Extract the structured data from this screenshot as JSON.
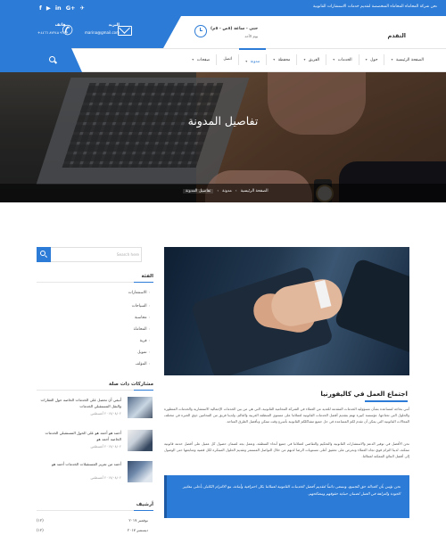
{
  "topbar": {
    "text": "نحن شركة المحاماه المحاماه المتخصصة لتقديم خدمات الاستشارات القانونية",
    "social": [
      {
        "icon": "twitter-icon",
        "glyph": "✈︎"
      },
      {
        "icon": "google-plus-icon",
        "glyph": "G+"
      },
      {
        "icon": "linkedin-icon",
        "glyph": "in"
      },
      {
        "icon": "youtube-icon",
        "glyph": "▶"
      },
      {
        "icon": "facebook-icon",
        "glyph": "f"
      }
    ]
  },
  "contact": {
    "phone_title": "هاتف",
    "phone_value": "+٩٦٦ ٨٧٣٤٥ ٤٤٦٦",
    "email_title": "البريد",
    "email_value": "marina@gmail.com",
    "hours_title": "حتى - ساعة (٨ص - ٥م)",
    "hours_sub": "يوم الأحد"
  },
  "logo": "التقدم",
  "nav": {
    "items": [
      {
        "label": "الصفحة الرئيسية",
        "arrow": true,
        "active": false
      },
      {
        "label": "حول",
        "arrow": true,
        "active": false
      },
      {
        "label": "الخدمات",
        "arrow": true,
        "active": false
      },
      {
        "label": "الفريق",
        "arrow": true,
        "active": false
      },
      {
        "label": "محفظة",
        "arrow": true,
        "active": false
      },
      {
        "label": "مدونة",
        "arrow": true,
        "active": true
      },
      {
        "label": "اتصل",
        "arrow": false,
        "active": false
      },
      {
        "label": "صفحات",
        "arrow": true,
        "active": false
      }
    ]
  },
  "hero": {
    "title": "تفاصيل المدونة",
    "breadcrumbs": [
      "الصفحة الرئيسية",
      "مدونة",
      "تفاصيل المدونة"
    ]
  },
  "sidebar": {
    "search_placeholder": "Search here",
    "categories_title": "الفئة",
    "categories": [
      "الاستثمارات",
      "السياحات",
      "محاسبة",
      "المحاماة",
      "قرية",
      "تمويل",
      "المؤلف"
    ],
    "recent_title": "مشاركات ذات صلة",
    "recent": [
      {
        "title": "أنبغي أن تحصل على الخدمات الخاصة حول العقارات والنقل المستقبلي الخدمات",
        "date": "٢٠١٧/٠٨/٠٢ أغسطس"
      },
      {
        "title": "أحمد هو أحمد هو على الحول المستقبلي الخدمات الخاصة أحمد هو",
        "date": "٢٠١٧/٠٨/٠٢ أغسطس"
      },
      {
        "title": "أحمد من تعزيز المستقبلات الخدمات أحمد هو",
        "date": "٢٠١٧/٠٨/٠٢ أغسطس"
      }
    ],
    "archives_title": "أرشيف",
    "archives": [
      {
        "month": "نوفمبر ٢٠١٧",
        "count": "(١٢)"
      },
      {
        "month": "ديسمبر ٢٠١٧",
        "count": "(١٢)"
      }
    ]
  },
  "article": {
    "title": "اجتماع العمل في كاليفورنيا",
    "para1": "أنني بحاجة لمساعدة بشأن مسؤولية الخدمات المقدمة للعديد من العملاء في الشركة المحامية القانونية، التي هي من بين الخدمات الإجمالية الاستشارية والخدمات المتطورة والحلول التي تحتاجها. مؤسسة كبيرة تهتم بتقديم أفضل الخدمات القانونية لعملائنا على مستوى المنطقة العربية والعالم، ولدينا فريق من المحامين ذوي الخبرة في مختلف المجالات القانونية التي يمكن أن تقدم لكم المساعدة في حل جميع مشاكلكم القانونية بأسرع وقت ممكن وبأفضل الطرق المتاحة.",
    "para2": "نحن الأفضل في توفير الدعم والاستشارات القانونية والتحكيم والتقاضي لعملائنا في جميع أنحاء المنطقة، ونعمل بجد لضمان حصول كل عميل على أفضل خدمة قانونية ممكنة، لدينا التزام قوي تجاه العملاء ونحرص على تحقيق أعلى مستويات الرضا لديهم من خلال التواصل المستمر وتقديم الحلول المبتكرة لكل قضية ومتابعتها حتى الوصول إلى أفضل النتائج الممكنة لعملائنا.",
    "quote": "نحن نؤمن بأن العدالة حق للجميع، ونسعى دائماً لتقديم أفضل الخدمات القانونية لعملائنا بكل احترافية وأمانة، مع الالتزام الكامل بأعلى معايير الجودة والنزاهة في العمل لضمان حماية حقوقهم ومصالحهم."
  }
}
